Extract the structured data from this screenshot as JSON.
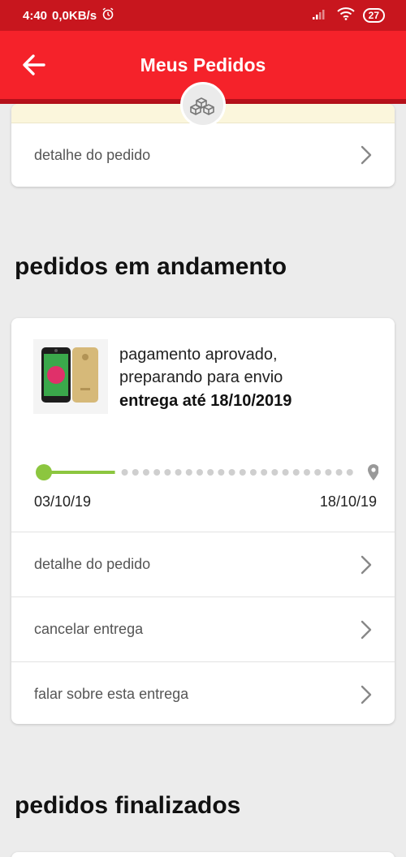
{
  "status_bar": {
    "time": "4:40",
    "speed": "0,0KB/s",
    "battery": "27"
  },
  "app_bar": {
    "title": "Meus Pedidos"
  },
  "previous_order": {
    "detail_label": "detalhe do pedido"
  },
  "sections": {
    "in_progress": "pedidos em andamento",
    "finished": "pedidos finalizados"
  },
  "order": {
    "status_line1": "pagamento aprovado,",
    "status_line2": "preparando para envio",
    "delivery": "entrega até 18/10/2019",
    "date_start": "03/10/19",
    "date_end": "18/10/19",
    "progress": 0.22,
    "actions": [
      {
        "label": "detalhe do pedido"
      },
      {
        "label": "cancelar entrega"
      },
      {
        "label": "falar sobre esta entrega"
      }
    ]
  },
  "colors": {
    "primary_red": "#f5222a",
    "status_red": "#c8161e",
    "progress_green": "#8cc63f",
    "dot_gray": "#cfcfcf"
  }
}
